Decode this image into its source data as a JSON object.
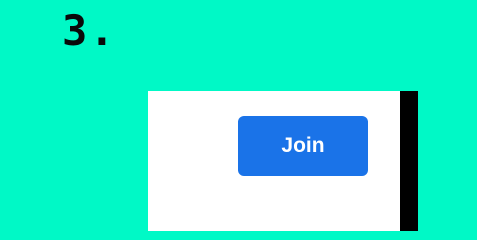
{
  "step": {
    "label": "3."
  },
  "panel": {
    "join_button_label": "Join"
  },
  "colors": {
    "background": "#00f9c6",
    "button": "#1a73e8",
    "panel": "#ffffff",
    "panel_edge": "#000000",
    "step_text": "#0a0a0a"
  }
}
